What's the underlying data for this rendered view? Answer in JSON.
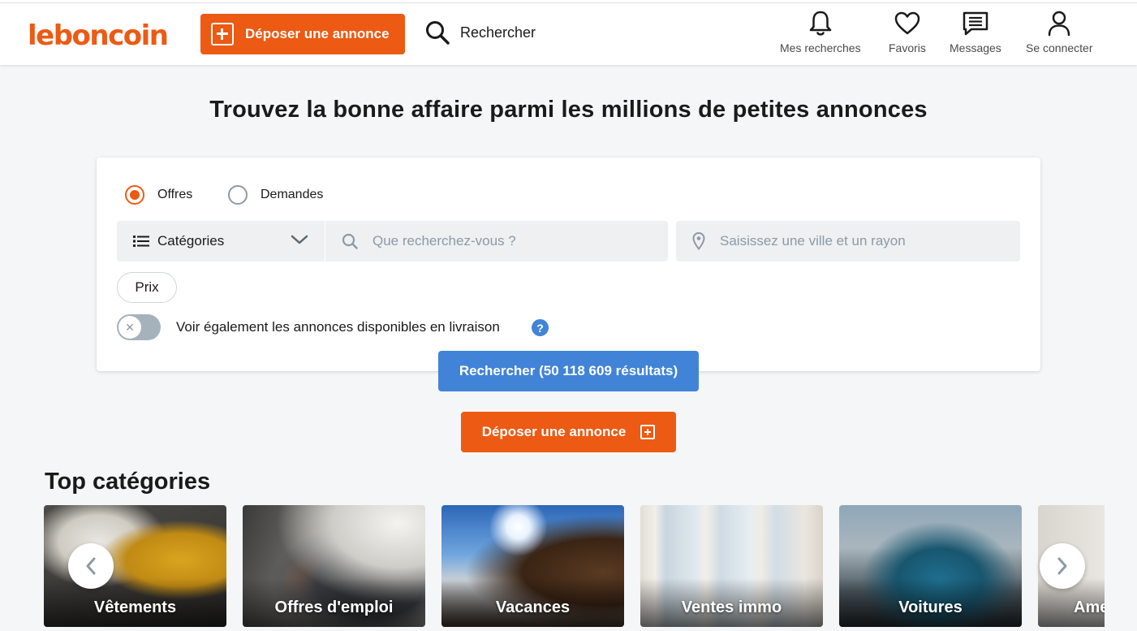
{
  "header": {
    "logo": "leboncoin",
    "deposer_label": "Déposer une annonce",
    "search_label": "Rechercher",
    "nav": {
      "mes_recherches": "Mes recherches",
      "favoris": "Favoris",
      "messages": "Messages",
      "se_connecter": "Se connecter"
    }
  },
  "hero": {
    "title": "Trouvez la bonne affaire parmi les millions de petites annonces"
  },
  "search_form": {
    "radio_offres": "Offres",
    "radio_demandes": "Demandes",
    "selected_radio": "Offres",
    "category_label": "Catégories",
    "query_placeholder": "Que recherchez-vous ?",
    "location_placeholder": "Saisissez une ville et un rayon",
    "price_label": "Prix",
    "delivery_label": "Voir également les annonces disponibles en livraison",
    "help_glyph": "?",
    "delivery_toggle_on": false,
    "toggle_glyph": "✕"
  },
  "actions": {
    "search_button": "Rechercher (50 118 609 résultats)",
    "deposer_button": "Déposer une annonce"
  },
  "top_categories": {
    "title": "Top catégories",
    "items": [
      {
        "label": "Vêtements"
      },
      {
        "label": "Offres d'emploi"
      },
      {
        "label": "Vacances"
      },
      {
        "label": "Ventes immo"
      },
      {
        "label": "Voitures"
      },
      {
        "label": "Ame"
      }
    ]
  },
  "colors": {
    "brand_orange": "#ec5a13",
    "primary_blue": "#4183d7",
    "page_background": "#f4f6f7"
  }
}
